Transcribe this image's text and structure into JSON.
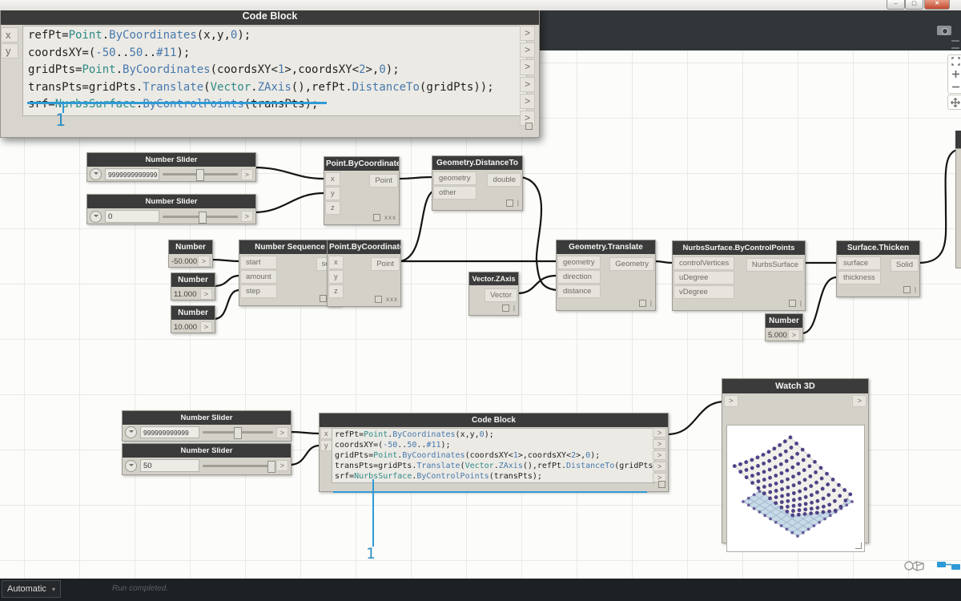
{
  "ui": {
    "gt": ">",
    "caret": "▾"
  },
  "window_controls": {
    "minimize": "–",
    "maximize": "▢",
    "close": "✕"
  },
  "icons": {
    "camera": "camera-icon",
    "menu": "menu-icon",
    "fit": "fit-view-icon",
    "zoom_in": "zoom-in-icon",
    "zoom_out": "zoom-out-icon",
    "pan": "pan-icon",
    "geometry_view": "geometry-view-icon",
    "graph_view": "graph-view-icon"
  },
  "code_lines": [
    [
      [
        "p",
        "refPt="
      ],
      [
        "t",
        "Point"
      ],
      [
        "p",
        "."
      ],
      [
        "b",
        "ByCoordinates"
      ],
      [
        "p",
        "(x,y,"
      ],
      [
        "b",
        "0"
      ],
      [
        "p",
        ");"
      ]
    ],
    [
      [
        "p",
        "coordsXY=("
      ],
      [
        "b",
        "-50"
      ],
      [
        "p",
        ".."
      ],
      [
        "b",
        "50"
      ],
      [
        "p",
        ".."
      ],
      [
        "b",
        "#11"
      ],
      [
        "p",
        ");"
      ]
    ],
    [
      [
        "p",
        "gridPts="
      ],
      [
        "t",
        "Point"
      ],
      [
        "p",
        "."
      ],
      [
        "b",
        "ByCoordinates"
      ],
      [
        "p",
        "(coordsXY<"
      ],
      [
        "b",
        "1"
      ],
      [
        "p",
        ">,coordsXY<"
      ],
      [
        "b",
        "2"
      ],
      [
        "p",
        ">,"
      ],
      [
        "b",
        "0"
      ],
      [
        "p",
        ");"
      ]
    ],
    [
      [
        "p",
        "transPts=gridPts."
      ],
      [
        "b",
        "Translate"
      ],
      [
        "p",
        "("
      ],
      [
        "t",
        "Vector"
      ],
      [
        "p",
        "."
      ],
      [
        "b",
        "ZAxis"
      ],
      [
        "p",
        "(),refPt."
      ],
      [
        "b",
        "DistanceTo"
      ],
      [
        "p",
        "(gridPts));"
      ]
    ],
    [
      [
        "p",
        "srf="
      ],
      [
        "t",
        "NurbsSurface"
      ],
      [
        "p",
        "."
      ],
      [
        "b",
        "ByControlPoints"
      ],
      [
        "p",
        "(transPts);"
      ]
    ]
  ],
  "overlay_code_block": {
    "title": "Code Block",
    "inputs": [
      "x",
      "y"
    ],
    "annotation": "1"
  },
  "nodes": {
    "slider_x_top": {
      "title": "Number Slider",
      "value": "9999999999999"
    },
    "slider_y_top": {
      "title": "Number Slider",
      "value": "0"
    },
    "point_by_coordinates_1": {
      "title": "Point.ByCoordinates",
      "inputs": [
        "x",
        "y",
        "z"
      ],
      "output": "Point",
      "lacing": "xxx"
    },
    "geometry_distance_to": {
      "title": "Geometry.DistanceTo",
      "inputs": [
        "geometry",
        "other"
      ],
      "output": "double",
      "lacing": "|"
    },
    "number_start": {
      "title": "Number",
      "value": "-50.000"
    },
    "number_amount": {
      "title": "Number",
      "value": "11.000"
    },
    "number_step": {
      "title": "Number",
      "value": "10.000"
    },
    "number_sequence": {
      "title": "Number Sequence",
      "inputs": [
        "start",
        "amount",
        "step"
      ],
      "output": "seq",
      "lacing": "||\\"
    },
    "point_by_coordinates_2": {
      "title": "Point.ByCoordinates",
      "inputs": [
        "x",
        "y",
        "z"
      ],
      "output": "Point",
      "lacing": "xxx"
    },
    "vector_zaxis": {
      "title": "Vector.ZAxis",
      "output": "Vector",
      "lacing": "|"
    },
    "geometry_translate": {
      "title": "Geometry.Translate",
      "inputs": [
        "geometry",
        "direction",
        "distance"
      ],
      "output": "Geometry",
      "lacing": "|"
    },
    "nurbs_surface": {
      "title": "NurbsSurface.ByControlPoints",
      "inputs": [
        "controlVertices",
        "uDegree",
        "vDegree"
      ],
      "output": "NurbsSurface",
      "lacing": "|"
    },
    "surface_thicken": {
      "title": "Surface.Thicken",
      "inputs": [
        "surface",
        "thickness"
      ],
      "output": "Solid",
      "lacing": "|"
    },
    "number_thickness": {
      "title": "Number",
      "value": "5.000"
    },
    "slider_x_bottom": {
      "title": "Number Slider",
      "value": "999999999999"
    },
    "slider_y_bottom": {
      "title": "Number Slider",
      "value": "50"
    },
    "code_block": {
      "title": "Code Block",
      "inputs": [
        "x",
        "y"
      ],
      "annotation": "1"
    },
    "watch_3d": {
      "title": "Watch 3D"
    }
  },
  "watch3d_preview": {
    "grid": 11,
    "dot_color": "#4f4287",
    "base_dot_color": "#6b5e9d",
    "base_fill": "#c7dae7",
    "base_line": "#9cb3ca",
    "surface_fill": "#f2f0ea",
    "surface_edge": "#d2cfc7"
  },
  "status_bar": {
    "run_mode": "Automatic",
    "message": "Run completed."
  }
}
